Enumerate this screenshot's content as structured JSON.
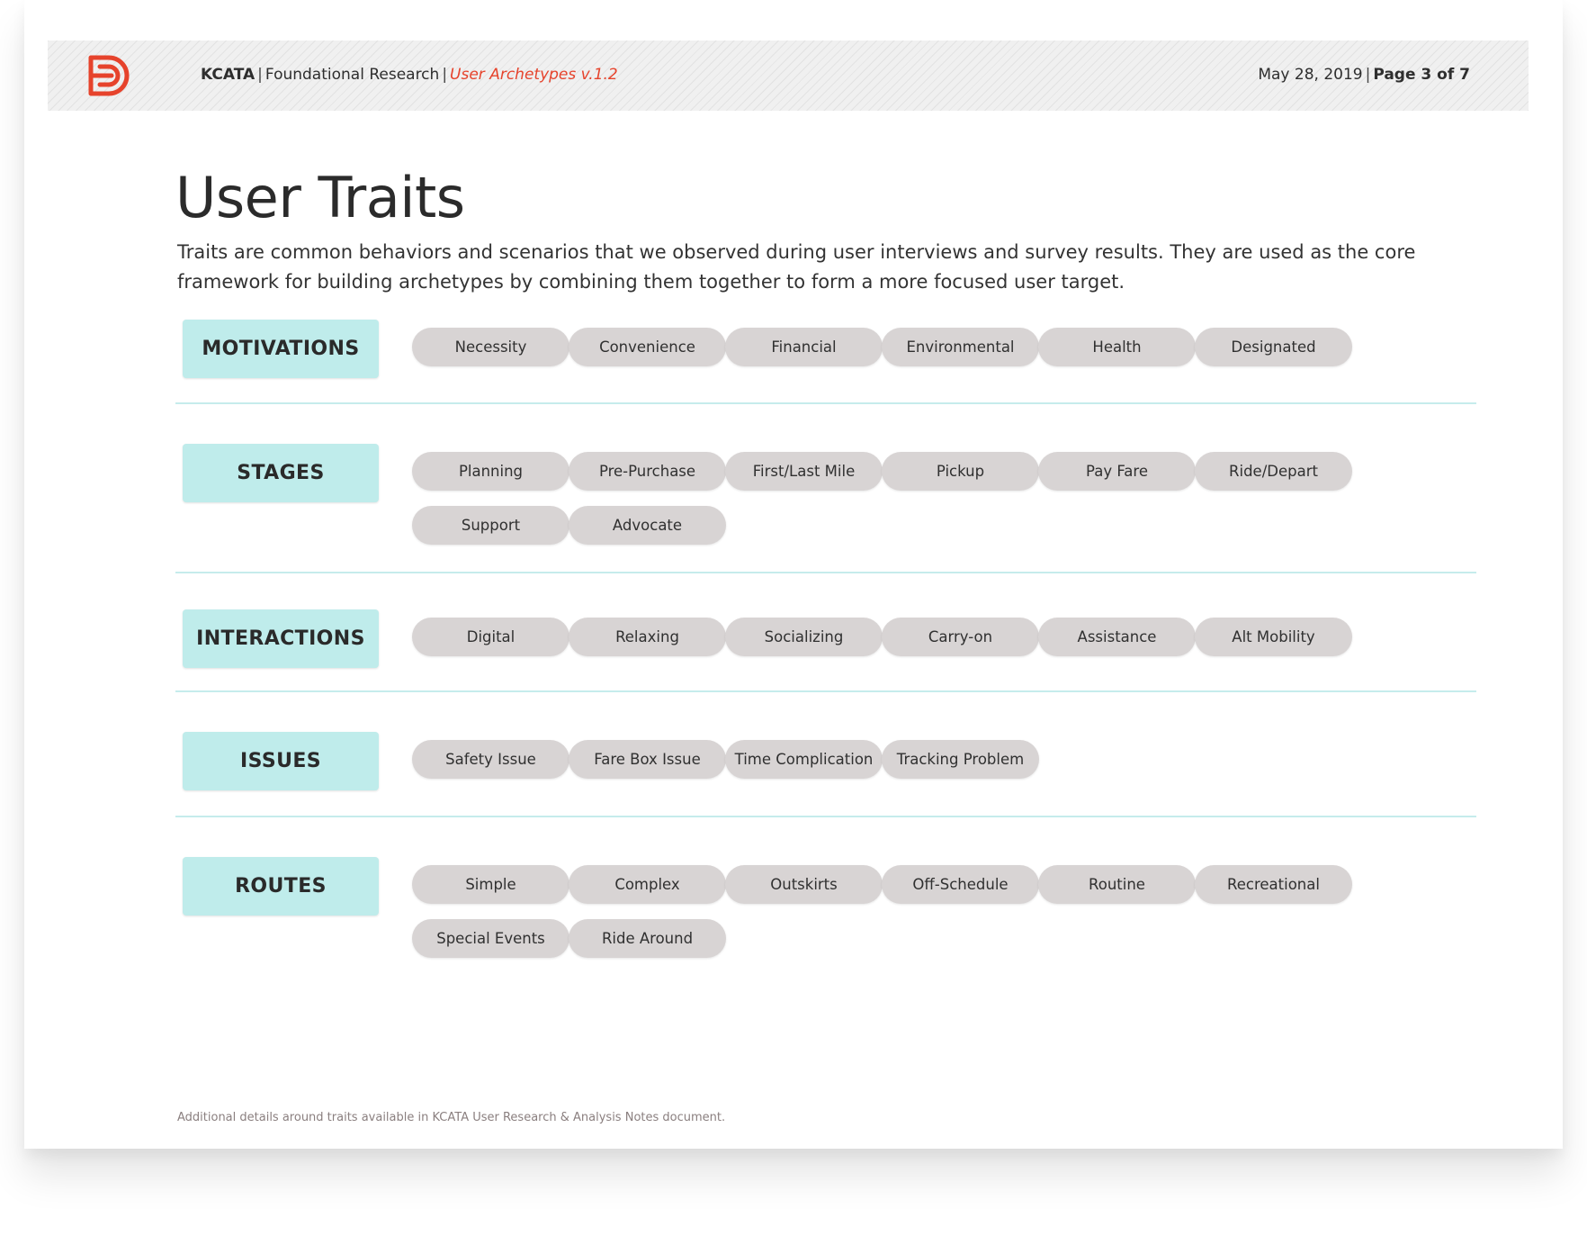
{
  "header": {
    "org": "KCATA",
    "project": "Foundational Research",
    "document": "User Archetypes v.1.2",
    "separator": "|",
    "date": "May 28, 2019",
    "page": "Page 3 of 7",
    "logo_icon": "d-logo-icon",
    "accent_color": "#e6432c"
  },
  "title": "User Traits",
  "intro": "Traits are common behaviors and scenarios that we observed during user interviews and survey results. They are used as the core framework for building archetypes by combining them together to form a more focused user target.",
  "colors": {
    "label_bg": "#bfeceb",
    "pill_bg": "#d8d4d4",
    "divider": "#c6ecec"
  },
  "sections": [
    {
      "label": "MOTIVATIONS",
      "traits": [
        "Necessity",
        "Convenience",
        "Financial",
        "Environmental",
        "Health",
        "Designated"
      ]
    },
    {
      "label": "STAGES",
      "traits": [
        "Planning",
        "Pre-Purchase",
        "First/Last Mile",
        "Pickup",
        "Pay Fare",
        "Ride/Depart",
        "Support",
        "Advocate"
      ]
    },
    {
      "label": "INTERACTIONS",
      "traits": [
        "Digital",
        "Relaxing",
        "Socializing",
        "Carry-on",
        "Assistance",
        "Alt Mobility"
      ]
    },
    {
      "label": "ISSUES",
      "traits": [
        "Safety Issue",
        "Fare Box Issue",
        "Time Complication",
        "Tracking Problem"
      ]
    },
    {
      "label": "ROUTES",
      "traits": [
        "Simple",
        "Complex",
        "Outskirts",
        "Off-Schedule",
        "Routine",
        "Recreational",
        "Special Events",
        "Ride Around"
      ]
    }
  ],
  "footnote": "Additional details around traits available in KCATA User Research & Analysis Notes document."
}
